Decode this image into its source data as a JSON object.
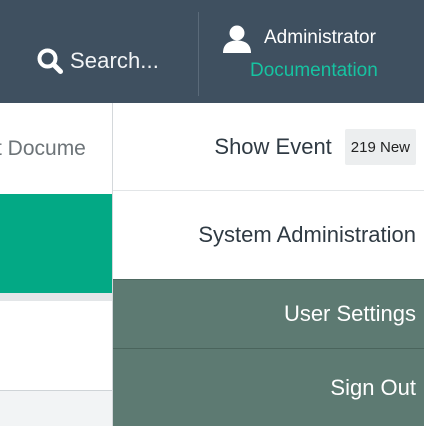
{
  "header": {
    "search_label": "Search...",
    "user_name": "Administrator",
    "docs_link": "Documentation",
    "colors": {
      "bar": "#3f5060",
      "accent": "#16c3a1"
    }
  },
  "background": {
    "tab_text": "t Docume"
  },
  "menu": {
    "items": [
      {
        "label": "Show Event",
        "badge": "219 New"
      },
      {
        "label": "System Administration"
      },
      {
        "label": "User Settings"
      },
      {
        "label": "Sign Out"
      }
    ],
    "colors": {
      "highlight": "#5d7a72"
    }
  },
  "icons": [
    "search-icon",
    "user-icon"
  ]
}
